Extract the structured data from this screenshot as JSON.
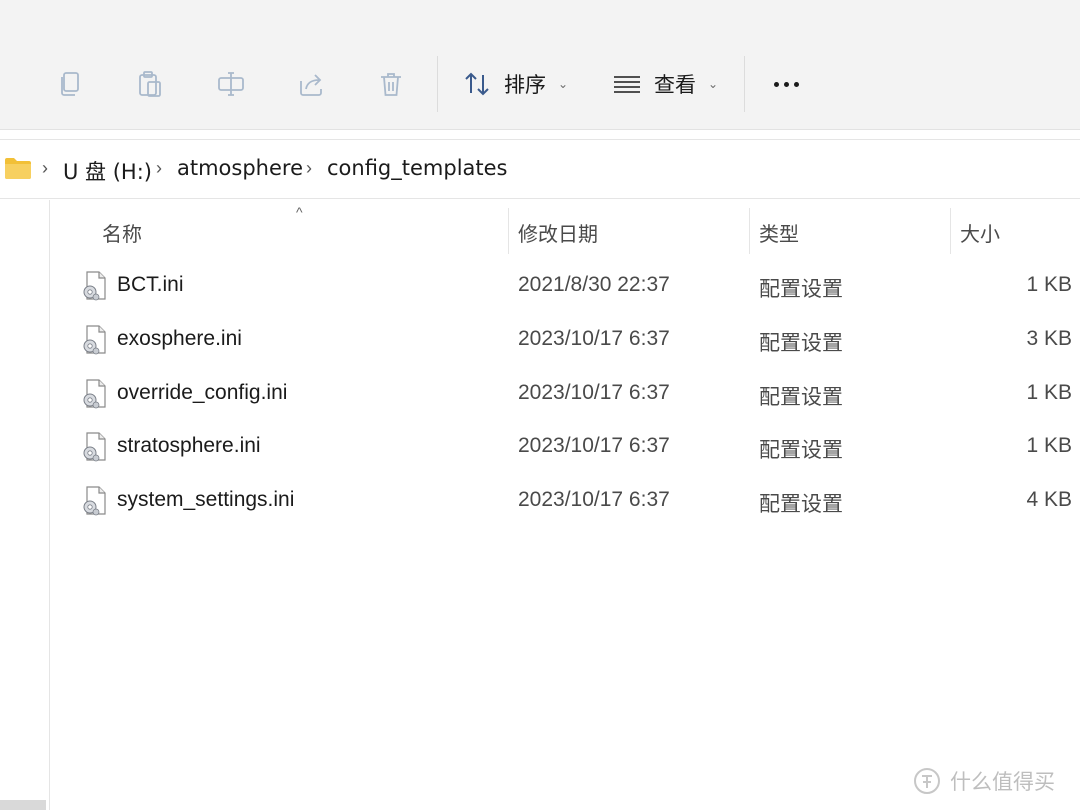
{
  "toolbar": {
    "buttons": [
      {
        "icon": "copy-icon"
      },
      {
        "icon": "paste-icon"
      },
      {
        "icon": "rename-icon"
      },
      {
        "icon": "share-icon"
      },
      {
        "icon": "delete-icon"
      }
    ],
    "sort_label": "排序",
    "view_label": "查看",
    "more_icon": "more-icon",
    "chevron": "⌄"
  },
  "breadcrumb": {
    "items": [
      "U 盘 (H:)",
      "atmosphere",
      "config_templates"
    ],
    "separator": "›"
  },
  "columns": {
    "name": "名称",
    "date": "修改日期",
    "type": "类型",
    "size": "大小",
    "sort_indicator": "^"
  },
  "files": [
    {
      "name": "BCT.ini",
      "date": "2021/8/30 22:37",
      "type": "配置设置",
      "size": "1 KB"
    },
    {
      "name": "exosphere.ini",
      "date": "2023/10/17 6:37",
      "type": "配置设置",
      "size": "3 KB"
    },
    {
      "name": "override_config.ini",
      "date": "2023/10/17 6:37",
      "type": "配置设置",
      "size": "1 KB"
    },
    {
      "name": "stratosphere.ini",
      "date": "2023/10/17 6:37",
      "type": "配置设置",
      "size": "1 KB"
    },
    {
      "name": "system_settings.ini",
      "date": "2023/10/17 6:37",
      "type": "配置设置",
      "size": "4 KB"
    }
  ],
  "watermark": {
    "text": "什么值得买"
  },
  "colors": {
    "toolbar_bg": "#f3f3f3",
    "icon_disabled": "#a9b9cc",
    "folder": "#f2c037"
  }
}
